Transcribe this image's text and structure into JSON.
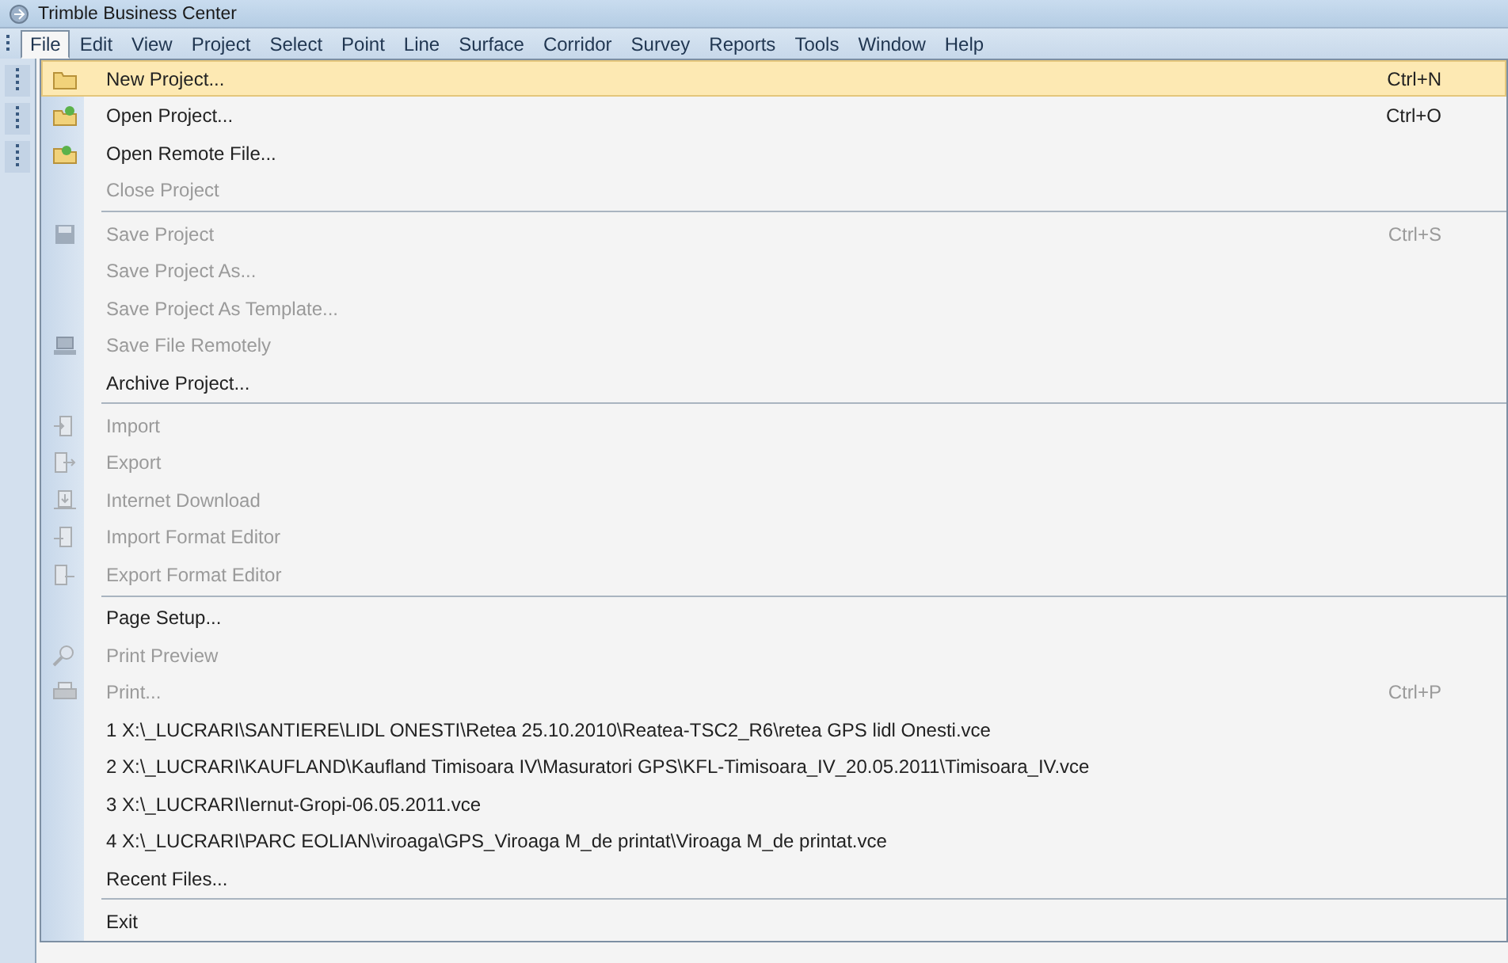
{
  "window": {
    "title": "Trimble Business Center"
  },
  "menubar": [
    {
      "label": "File",
      "selected": true
    },
    {
      "label": "Edit",
      "selected": false
    },
    {
      "label": "View",
      "selected": false
    },
    {
      "label": "Project",
      "selected": false
    },
    {
      "label": "Select",
      "selected": false
    },
    {
      "label": "Point",
      "selected": false
    },
    {
      "label": "Line",
      "selected": false
    },
    {
      "label": "Surface",
      "selected": false
    },
    {
      "label": "Corridor",
      "selected": false
    },
    {
      "label": "Survey",
      "selected": false
    },
    {
      "label": "Reports",
      "selected": false
    },
    {
      "label": "Tools",
      "selected": false
    },
    {
      "label": "Window",
      "selected": false
    },
    {
      "label": "Help",
      "selected": false
    }
  ],
  "file_menu": [
    {
      "kind": "item",
      "label": "New Project...",
      "shortcut": "Ctrl+N",
      "disabled": false,
      "selected": true
    },
    {
      "kind": "item",
      "label": "Open Project...",
      "shortcut": "Ctrl+O",
      "disabled": false,
      "selected": false
    },
    {
      "kind": "item",
      "label": "Open Remote File...",
      "disabled": false,
      "selected": false
    },
    {
      "kind": "item",
      "label": "Close Project",
      "disabled": true,
      "selected": false
    },
    {
      "kind": "separator"
    },
    {
      "kind": "item",
      "label": "Save Project",
      "shortcut": "Ctrl+S",
      "disabled": true,
      "selected": false
    },
    {
      "kind": "item",
      "label": "Save Project As...",
      "disabled": true,
      "selected": false
    },
    {
      "kind": "item",
      "label": "Save Project As Template...",
      "disabled": true,
      "selected": false
    },
    {
      "kind": "item",
      "label": "Save File Remotely",
      "disabled": true,
      "selected": false
    },
    {
      "kind": "item",
      "label": "Archive Project...",
      "disabled": false,
      "selected": false
    },
    {
      "kind": "separator"
    },
    {
      "kind": "item",
      "label": "Import",
      "disabled": true,
      "selected": false
    },
    {
      "kind": "item",
      "label": "Export",
      "disabled": true,
      "selected": false
    },
    {
      "kind": "item",
      "label": "Internet Download",
      "disabled": true,
      "selected": false
    },
    {
      "kind": "item",
      "label": "Import Format Editor",
      "disabled": true,
      "selected": false
    },
    {
      "kind": "item",
      "label": "Export Format Editor",
      "disabled": true,
      "selected": false
    },
    {
      "kind": "separator"
    },
    {
      "kind": "item",
      "label": "Page Setup...",
      "disabled": false,
      "selected": false
    },
    {
      "kind": "item",
      "label": "Print Preview",
      "disabled": true,
      "selected": false
    },
    {
      "kind": "item",
      "label": "Print...",
      "shortcut": "Ctrl+P",
      "disabled": true,
      "selected": false
    },
    {
      "kind": "item",
      "label": "1 X:\\_LUCRARI\\SANTIERE\\LIDL ONESTI\\Retea 25.10.2010\\Reatea-TSC2_R6\\retea GPS lidl Onesti.vce",
      "disabled": false,
      "selected": false
    },
    {
      "kind": "item",
      "label": "2 X:\\_LUCRARI\\KAUFLAND\\Kaufland Timisoara IV\\Masuratori GPS\\KFL-Timisoara_IV_20.05.2011\\Timisoara_IV.vce",
      "disabled": false,
      "selected": false
    },
    {
      "kind": "item",
      "label": "3 X:\\_LUCRARI\\Iernut-Gropi-06.05.2011.vce",
      "disabled": false,
      "selected": false
    },
    {
      "kind": "item",
      "label": "4 X:\\_LUCRARI\\PARC EOLIAN\\viroaga\\GPS_Viroaga M_de printat\\Viroaga M_de printat.vce",
      "disabled": false,
      "selected": false
    },
    {
      "kind": "item",
      "label": "Recent Files...",
      "disabled": false,
      "selected": false
    },
    {
      "kind": "separator"
    },
    {
      "kind": "item",
      "label": "Exit",
      "disabled": false,
      "selected": false
    }
  ]
}
